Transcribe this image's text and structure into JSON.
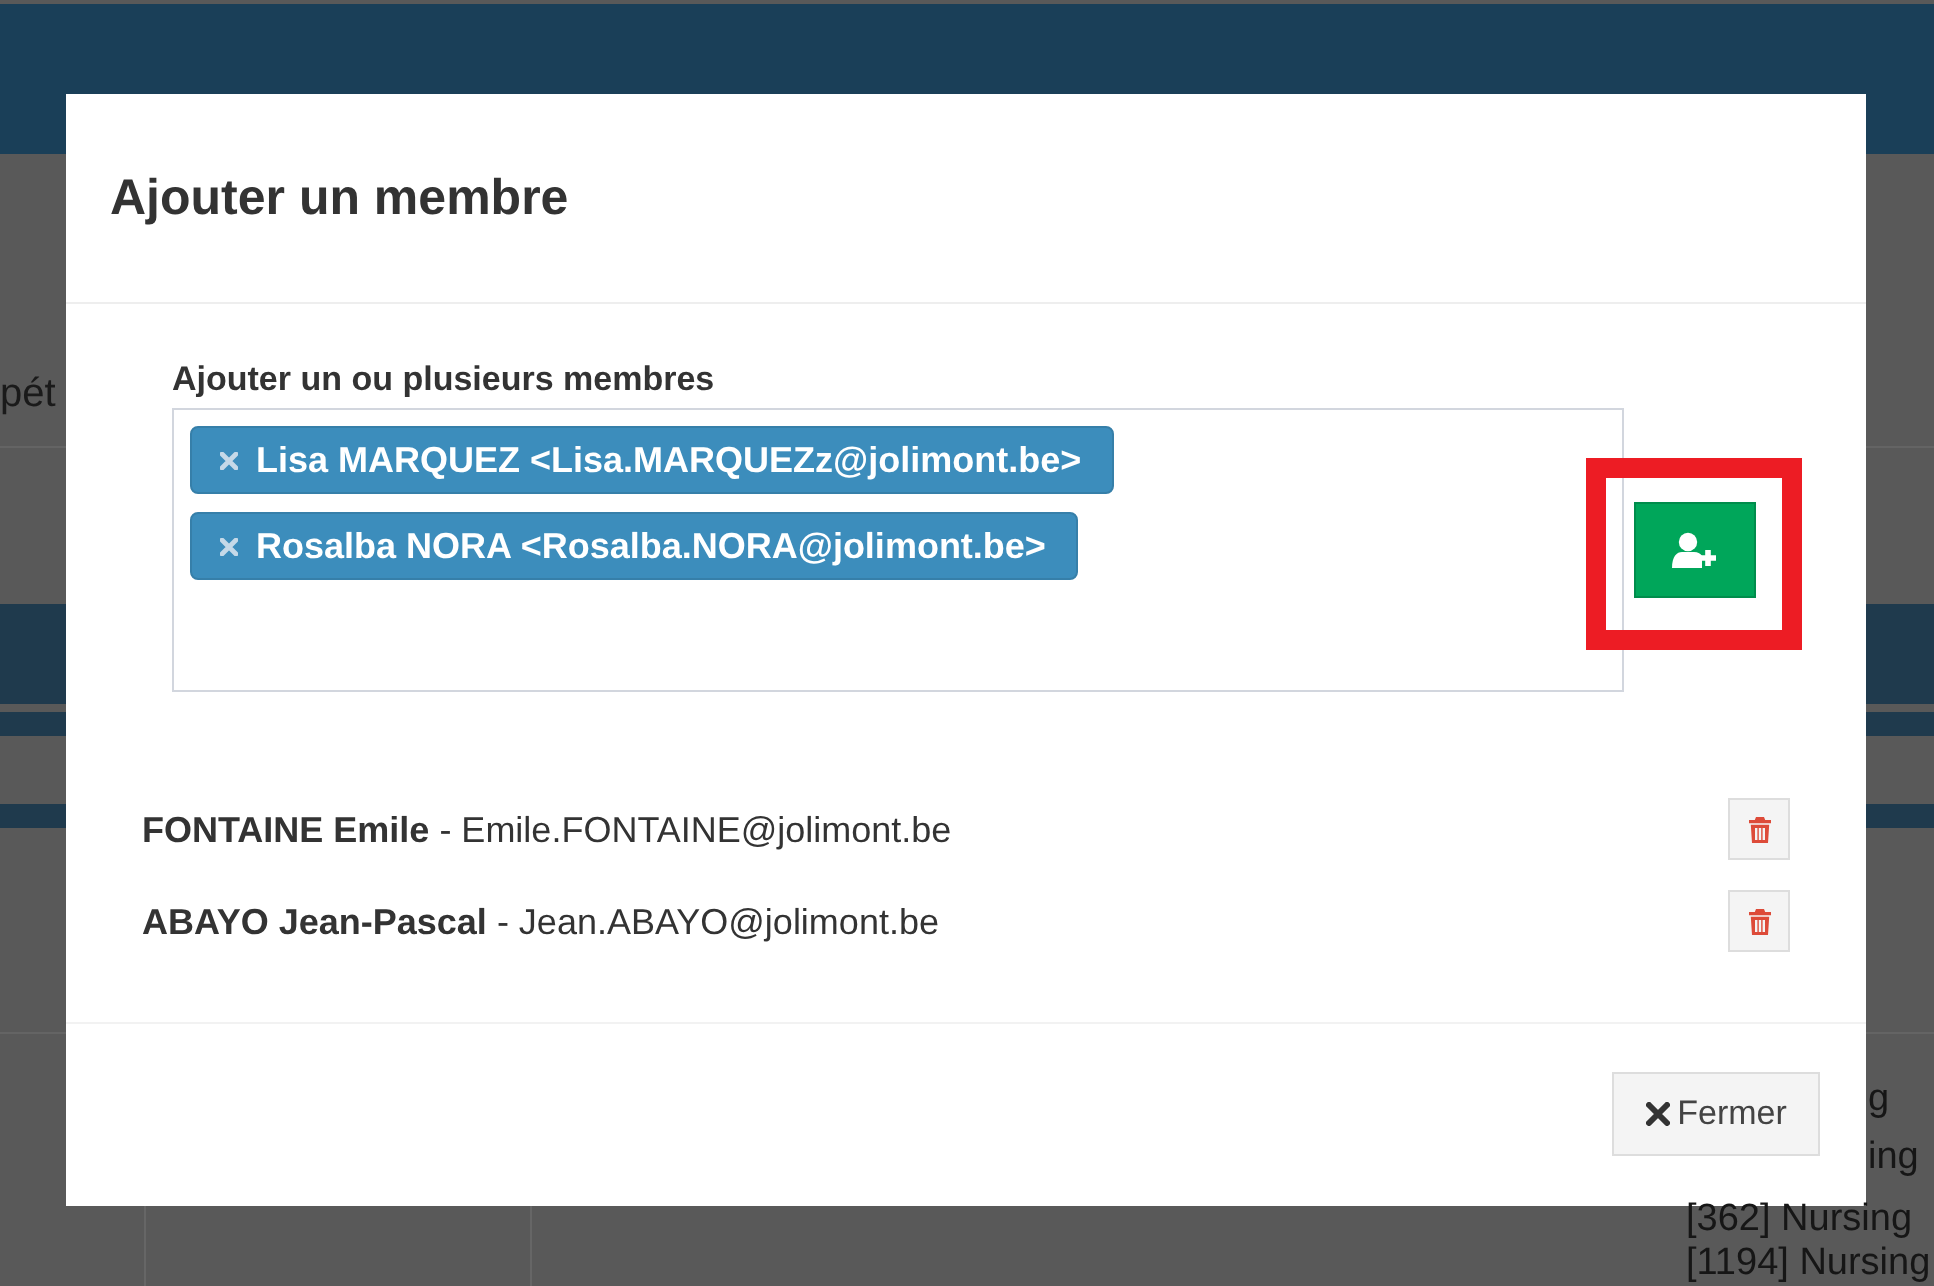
{
  "background": {
    "left_text": "pét",
    "right_lines": [
      "g",
      "ing",
      "[362] Nursing",
      "[1194] Nursing"
    ]
  },
  "modal": {
    "title": "Ajouter un membre",
    "field": {
      "label": "Ajouter un ou plusieurs membres",
      "tags": [
        {
          "text": "Lisa MARQUEZ <Lisa.MARQUEZz@jolimont.be>"
        },
        {
          "text": "Rosalba NORA <Rosalba.NORA@jolimont.be>"
        }
      ]
    },
    "add_button": {
      "highlighted": true
    },
    "members": [
      {
        "text": "**FONTAINE Emile** - Emile.FONTAINE@jolimont.be"
      },
      {
        "text": "**ABAYO Jean-Pascal** - Jean.ABAYO@jolimont.be"
      }
    ],
    "close_button": {
      "label": "Fermer"
    }
  }
}
